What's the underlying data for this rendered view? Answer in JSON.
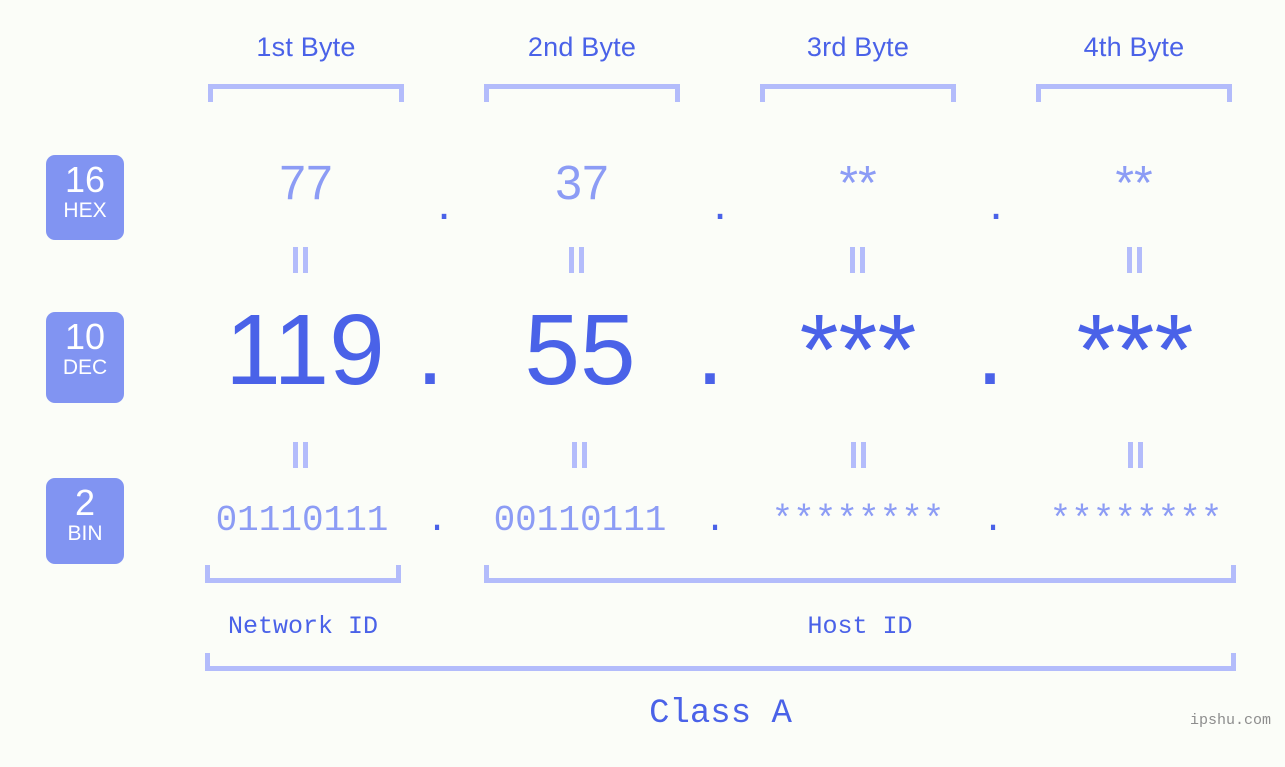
{
  "meta": {
    "background_color": "#fbfdf8",
    "accent_strong": "#4a62e8",
    "accent_light": "#8c9cf5",
    "bracket_color": "#b3bcfb",
    "badge_bg": "#8194f2",
    "watermark_color": "#8d8d8d"
  },
  "byte_headers": [
    {
      "label": "1st Byte"
    },
    {
      "label": "2nd Byte"
    },
    {
      "label": "3rd Byte"
    },
    {
      "label": "4th Byte"
    }
  ],
  "bases": [
    {
      "number": "16",
      "name": "HEX"
    },
    {
      "number": "10",
      "name": "DEC"
    },
    {
      "number": "2",
      "name": "BIN"
    }
  ],
  "rows": {
    "hex": {
      "base_number": "16",
      "base_name": "HEX",
      "values": [
        "77",
        "37",
        "**",
        "**"
      ],
      "separator": "."
    },
    "dec": {
      "base_number": "10",
      "base_name": "DEC",
      "values": [
        "119",
        "55",
        "***",
        "***"
      ],
      "separator": "."
    },
    "bin": {
      "base_number": "2",
      "base_name": "BIN",
      "values": [
        "01110111",
        "00110111",
        "********",
        "********"
      ],
      "separator": "."
    }
  },
  "equals_separators": {
    "glyph": "=",
    "count_per_gap": 4
  },
  "id_sections": [
    {
      "label": "Network ID"
    },
    {
      "label": "Host ID"
    }
  ],
  "class_label": "Class A",
  "watermark": "ipshu.com"
}
